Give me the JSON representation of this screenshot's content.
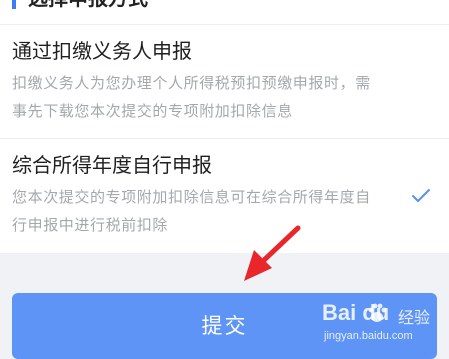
{
  "section": {
    "title": "选择申报方式"
  },
  "options": [
    {
      "title": "通过扣缴义务人申报",
      "description": "扣缴义务人为您办理个人所得税预扣预缴申报时，需事先下载您本次提交的专项附加扣除信息",
      "selected": false
    },
    {
      "title": "综合所得年度自行申报",
      "description": "您本次提交的专项附加扣除信息可在综合所得年度自行申报中进行税前扣除",
      "selected": true
    }
  ],
  "submit": {
    "label": "提交"
  },
  "watermark": {
    "logo_text": "Bai du",
    "cn_text": "经验",
    "url": "jingyan.baidu.com"
  },
  "colors": {
    "accent": "#3d7cf2",
    "button": "#5e94f5",
    "check": "#5b8ff0",
    "arrow": "#e8262b"
  }
}
